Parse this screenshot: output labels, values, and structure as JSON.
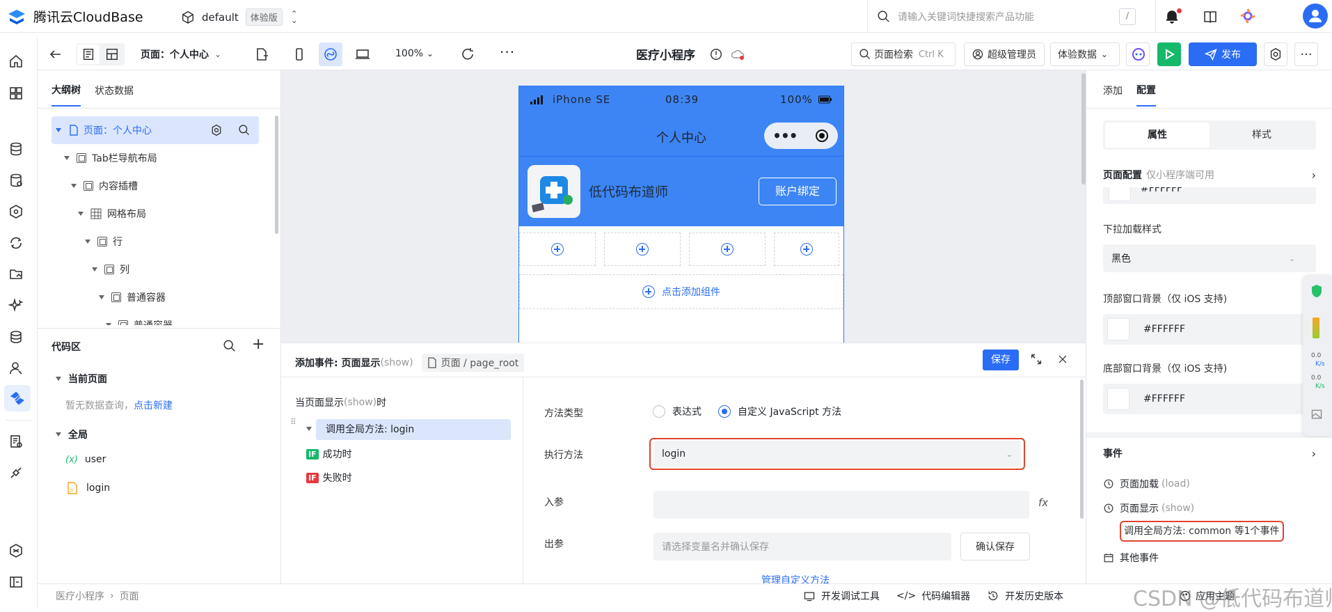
{
  "topbar": {
    "brand": "腾讯云CloudBase",
    "env_name": "default",
    "env_badge": "体验版",
    "search_placeholder": "请输入关键词快捷搜索产品功能",
    "search_shortcut": "/"
  },
  "toolbar": {
    "page_label": "页面：个人中心",
    "zoom": "100%",
    "app_title": "医疗小程序",
    "page_search": "页面检索",
    "page_search_shortcut": "Ctrl K",
    "role": "超级管理员",
    "data_mode": "体验数据",
    "publish": "发布"
  },
  "outline": {
    "tabs": [
      "大纲树",
      "状态数据"
    ],
    "items": [
      {
        "label": "页面：个人中心"
      },
      {
        "label": "Tab栏导航布局"
      },
      {
        "label": "内容插槽"
      },
      {
        "label": "网格布局"
      },
      {
        "label": "行"
      },
      {
        "label": "列"
      },
      {
        "label": "普通容器"
      },
      {
        "label": "普通容器"
      }
    ]
  },
  "code_area": {
    "title": "代码区",
    "current_page": "当前页面",
    "empty_text": "暂无数据查询，",
    "empty_link": "点击新建",
    "global": "全局",
    "global_items": [
      "user",
      "login"
    ],
    "var_symbol": "(x)"
  },
  "phone": {
    "device": "iPhone SE",
    "time": "08:39",
    "battery": "100%",
    "nav_title": "个人中心",
    "user_name": "低代码布道师",
    "bind_button": "账户绑定",
    "add_component": "点击添加组件"
  },
  "event_editor": {
    "title": "添加事件: 页面显示",
    "title_hint": "(show)",
    "breadcrumb": "页面 / page_root",
    "save": "保存",
    "trigger_label": "当页面显示",
    "trigger_hint": "(show)",
    "trigger_suffix": "时",
    "action_item": "调用全局方法: login",
    "success": "成功时",
    "failure": "失败时",
    "if_tag": "IF",
    "method_type_label": "方法类型",
    "method_type_options": [
      "表达式",
      "自定义 JavaScript 方法"
    ],
    "method_type_selected": "自定义 JavaScript 方法",
    "exec_label": "执行方法",
    "exec_value": "login",
    "input_label": "入参",
    "output_label": "出参",
    "output_placeholder": "请选择变量名并确认保存",
    "confirm_save": "确认保存",
    "manage_link": "管理自定义方法"
  },
  "right_panel": {
    "tabs": [
      "添加",
      "配置"
    ],
    "active_tab": "配置",
    "subtabs": [
      "属性",
      "样式"
    ],
    "active_subtab": "属性",
    "page_config_title": "页面配置",
    "page_config_hint": "仅小程序端可用",
    "partial_color": "#FFFFFF",
    "pulldown_label": "下拉加载样式",
    "pulldown_value": "黑色",
    "top_bg_label": "顶部窗口背景（仅 iOS 支持)",
    "top_bg_value": "#FFFFFF",
    "bottom_bg_label": "底部窗口背景（仅 iOS 支持)",
    "bottom_bg_value": "#FFFFFF",
    "events_title": "事件",
    "events": [
      {
        "label": "页面加载",
        "hint": "(load)"
      },
      {
        "label": "页面显示",
        "hint": "(show)"
      }
    ],
    "event_action": "调用全局方法: common 等1个事件",
    "other_events": "其他事件"
  },
  "floating_widget": {
    "rates": [
      "0.0",
      "K/s",
      "0.0",
      "K/s"
    ]
  },
  "statusbar": {
    "breadcrumb": [
      "医疗小程序",
      "页面"
    ],
    "tools": [
      "开发调试工具",
      "代码编辑器",
      "开发历史版本"
    ],
    "theme": "应用主题",
    "watermark": "CSDN @低代码布道师"
  },
  "colors": {
    "primary": "#2a6df4",
    "phone_header": "#3d85f5",
    "highlight_red": "#e0442f",
    "publish_green": "#16b86a"
  }
}
